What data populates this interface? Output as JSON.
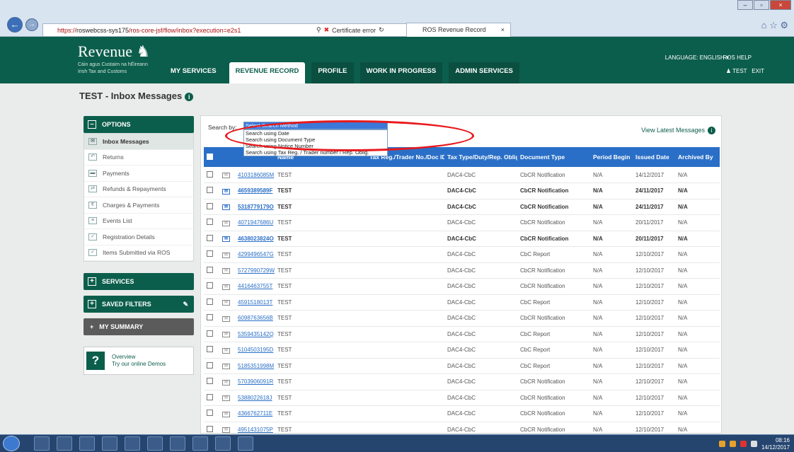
{
  "browser": {
    "url_prefix": "https://",
    "url_host": "roswebcss-sys175",
    "url_path": "/ros-core-jsf/flow/inbox?execution=e2s1",
    "search_icon": "magnifier-icon",
    "cert_error": "Certificate error",
    "tab_title": "ROS Revenue Record",
    "tab_close": "×",
    "window_controls": [
      "–",
      "▫",
      "×"
    ]
  },
  "header": {
    "logo_text": "Revenue",
    "logo_sub1": "Cáin agus Custaim na hÉireann",
    "logo_sub2": "Irish Tax and Customs",
    "nav": [
      "MY SERVICES",
      "REVENUE RECORD",
      "PROFILE",
      "WORK IN PROGRESS",
      "ADMIN SERVICES"
    ],
    "active_nav": "REVENUE RECORD",
    "language": "LANGUAGE: ENGLISH",
    "ros_help": "ROS HELP",
    "user": "TEST",
    "exit": "EXIT"
  },
  "page": {
    "title": "TEST - Inbox Messages"
  },
  "sidebar": {
    "options_label": "OPTIONS",
    "items": [
      {
        "label": "Inbox Messages",
        "icon": "envelope-icon"
      },
      {
        "label": "Returns",
        "icon": "returns-icon"
      },
      {
        "label": "Payments",
        "icon": "card-icon"
      },
      {
        "label": "Refunds & Repayments",
        "icon": "refund-icon"
      },
      {
        "label": "Charges & Payments",
        "icon": "charges-icon"
      },
      {
        "label": "Events List",
        "icon": "list-icon"
      },
      {
        "label": "Registration Details",
        "icon": "check-icon"
      },
      {
        "label": "Items Submitted via ROS",
        "icon": "check-icon"
      }
    ],
    "services_label": "SERVICES",
    "saved_filters_label": "SAVED FILTERS",
    "my_summary_label": "MY SUMMARY",
    "help_title": "Overview",
    "help_sub": "Try our online Demos"
  },
  "search": {
    "label": "Search by:",
    "selected": "Select Search Method",
    "options": [
      "Search using Date",
      "Search using Document Type",
      "Search using Notice Number",
      "Search using Tax Reg. / Trader number / Rep. Oblig."
    ]
  },
  "view_latest": "View Latest Messages",
  "table": {
    "headers": [
      "",
      "",
      "",
      "Name",
      "Tax Reg./Trader No./Doc ID",
      "Tax Type/Duty/Rep. Oblig.",
      "Document Type",
      "Period Begin",
      "Issued Date",
      "Archived By"
    ],
    "rows": [
      {
        "notice": "4103186085M",
        "name": "TEST",
        "tax": "DAC4-CbC",
        "doc": "CbCR Notification",
        "period": "N/A",
        "issued": "14/12/2017",
        "archived": "N/A",
        "unread": false
      },
      {
        "notice": "4659389589F",
        "name": "TEST",
        "tax": "DAC4-CbC",
        "doc": "CbCR Notification",
        "period": "N/A",
        "issued": "24/11/2017",
        "archived": "N/A",
        "unread": true
      },
      {
        "notice": "5318779179O",
        "name": "TEST",
        "tax": "DAC4-CbC",
        "doc": "CbCR Notification",
        "period": "N/A",
        "issued": "24/11/2017",
        "archived": "N/A",
        "unread": true
      },
      {
        "notice": "4071947686U",
        "name": "TEST",
        "tax": "DAC4-CbC",
        "doc": "CbCR Notification",
        "period": "N/A",
        "issued": "20/11/2017",
        "archived": "N/A",
        "unread": false
      },
      {
        "notice": "4638023824O",
        "name": "TEST",
        "tax": "DAC4-CbC",
        "doc": "CbCR Notification",
        "period": "N/A",
        "issued": "20/11/2017",
        "archived": "N/A",
        "unread": true
      },
      {
        "notice": "4299496547G",
        "name": "TEST",
        "tax": "DAC4-CbC",
        "doc": "CbC Report",
        "period": "N/A",
        "issued": "12/10/2017",
        "archived": "N/A",
        "unread": false
      },
      {
        "notice": "5727990729W",
        "name": "TEST",
        "tax": "DAC4-CbC",
        "doc": "CbCR Notification",
        "period": "N/A",
        "issued": "12/10/2017",
        "archived": "N/A",
        "unread": false
      },
      {
        "notice": "4416463755T",
        "name": "TEST",
        "tax": "DAC4-CbC",
        "doc": "CbCR Notification",
        "period": "N/A",
        "issued": "12/10/2017",
        "archived": "N/A",
        "unread": false
      },
      {
        "notice": "4591518013T",
        "name": "TEST",
        "tax": "DAC4-CbC",
        "doc": "CbC Report",
        "period": "N/A",
        "issued": "12/10/2017",
        "archived": "N/A",
        "unread": false
      },
      {
        "notice": "6098763656B",
        "name": "TEST",
        "tax": "DAC4-CbC",
        "doc": "CbCR Notification",
        "period": "N/A",
        "issued": "12/10/2017",
        "archived": "N/A",
        "unread": false
      },
      {
        "notice": "5359435142Q",
        "name": "TEST",
        "tax": "DAC4-CbC",
        "doc": "CbC Report",
        "period": "N/A",
        "issued": "12/10/2017",
        "archived": "N/A",
        "unread": false
      },
      {
        "notice": "5104503195D",
        "name": "TEST",
        "tax": "DAC4-CbC",
        "doc": "CbC Report",
        "period": "N/A",
        "issued": "12/10/2017",
        "archived": "N/A",
        "unread": false
      },
      {
        "notice": "5185351998M",
        "name": "TEST",
        "tax": "DAC4-CbC",
        "doc": "CbC Report",
        "period": "N/A",
        "issued": "12/10/2017",
        "archived": "N/A",
        "unread": false
      },
      {
        "notice": "5703906091R",
        "name": "TEST",
        "tax": "DAC4-CbC",
        "doc": "CbCR Notification",
        "period": "N/A",
        "issued": "12/10/2017",
        "archived": "N/A",
        "unread": false
      },
      {
        "notice": "5388022618J",
        "name": "TEST",
        "tax": "DAC4-CbC",
        "doc": "CbCR Notification",
        "period": "N/A",
        "issued": "12/10/2017",
        "archived": "N/A",
        "unread": false
      },
      {
        "notice": "4366762711E",
        "name": "TEST",
        "tax": "DAC4-CbC",
        "doc": "CbCR Notification",
        "period": "N/A",
        "issued": "12/10/2017",
        "archived": "N/A",
        "unread": false
      },
      {
        "notice": "4951431075P",
        "name": "TEST",
        "tax": "DAC4-CbC",
        "doc": "CbCR Notification",
        "period": "N/A",
        "issued": "12/10/2017",
        "archived": "N/A",
        "unread": false
      }
    ]
  },
  "taskbar": {
    "time": "08:16",
    "date": "14/12/2017"
  },
  "colors": {
    "brand_green": "#0c5e4c",
    "table_header_blue": "#2a6fc7",
    "annotation_red": "#e8191c"
  }
}
